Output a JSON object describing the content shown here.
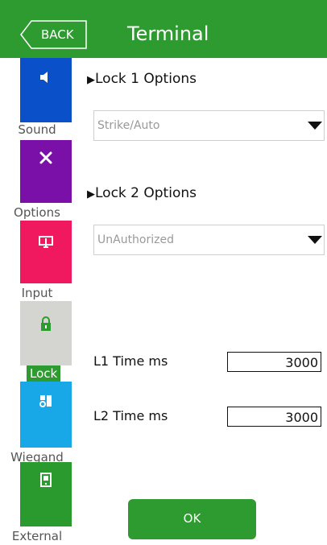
{
  "header": {
    "back_label": "BACK",
    "title": "Terminal"
  },
  "sidebar": {
    "items": [
      {
        "label": "Sound",
        "icon": "speaker-icon",
        "color": "#0a50c8"
      },
      {
        "label": "Options",
        "icon": "tools-icon",
        "color": "#7a10a8"
      },
      {
        "label": "Input",
        "icon": "input-icon",
        "color": "#f0185e"
      },
      {
        "label": "Lock",
        "icon": "lock-icon",
        "color": "#d4d4d0",
        "active": true
      },
      {
        "label": "Wiegand",
        "icon": "wiegand-icon",
        "color": "#18a8e8"
      },
      {
        "label": "External",
        "icon": "external-icon",
        "color": "#2a9a2e"
      }
    ],
    "active_label_color": "#2e9b30"
  },
  "main": {
    "lock1": {
      "title": "Lock 1 Options",
      "value": "Strike/Auto"
    },
    "lock2": {
      "title": "Lock 2 Options",
      "value": "UnAuthorized"
    },
    "l1_time": {
      "label": "L1 Time ms",
      "value": "3000"
    },
    "l2_time": {
      "label": "L2 Time ms",
      "value": "3000"
    },
    "ok_label": "OK"
  },
  "colors": {
    "accent": "#2e9b30"
  }
}
